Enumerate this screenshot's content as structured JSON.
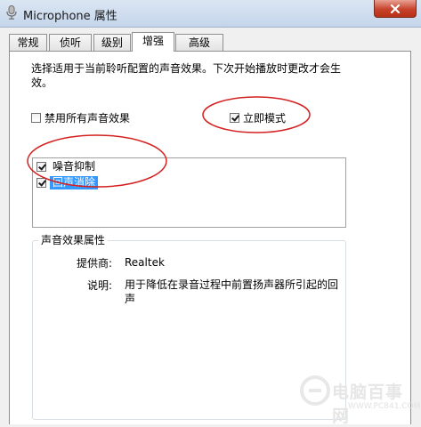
{
  "window": {
    "title": "Microphone 属性"
  },
  "tabs": [
    {
      "label": "常规",
      "active": false
    },
    {
      "label": "侦听",
      "active": false
    },
    {
      "label": "级别",
      "active": false
    },
    {
      "label": "增强",
      "active": true
    },
    {
      "label": "高级",
      "active": false
    }
  ],
  "enhancements": {
    "description": "选择适用于当前聆听配置的声音效果。下次开始播放时更改才会生效。",
    "disable_all_label": "禁用所有声音效果",
    "disable_all_checked": false,
    "immediate_mode_label": "立即模式",
    "immediate_mode_checked": true,
    "effects": [
      {
        "label": "噪音抑制",
        "checked": true,
        "selected": false
      },
      {
        "label": "回声消除",
        "checked": true,
        "selected": true
      }
    ]
  },
  "properties": {
    "group_title": "声音效果属性",
    "provider_label": "提供商:",
    "provider_value": "Realtek",
    "description_label": "说明:",
    "description_value": "用于降低在录音过程中前置扬声器所引起的回声"
  },
  "watermark": {
    "text": "电脑百事网",
    "url": "WWW.PC841.COM"
  },
  "colors": {
    "annotation": "#d42020",
    "selection": "#3399ff"
  }
}
